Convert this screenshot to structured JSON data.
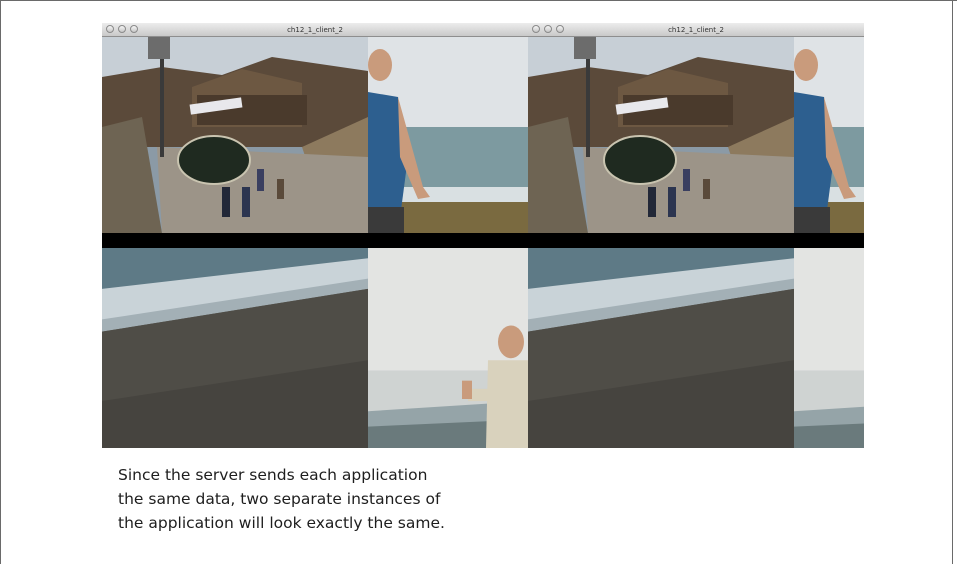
{
  "windows": [
    {
      "title": "ch12_1_client_2"
    },
    {
      "title": "ch12_1_client_2"
    }
  ],
  "video_tiles": [
    {
      "scene": "beach-town-street"
    },
    {
      "scene": "man-on-beach"
    },
    {
      "scene": "shoreline"
    },
    {
      "scene": "man-thumbs-up-overcast"
    }
  ],
  "caption": {
    "lines": [
      "Since the server sends each application",
      "the same data, two separate instances of",
      "the application will look exactly the same."
    ]
  },
  "colors": {
    "window_background": "#000000",
    "titlebar_top": "#ececec",
    "titlebar_bottom": "#c9c9c9",
    "caption_text": "#1e1e1e"
  }
}
